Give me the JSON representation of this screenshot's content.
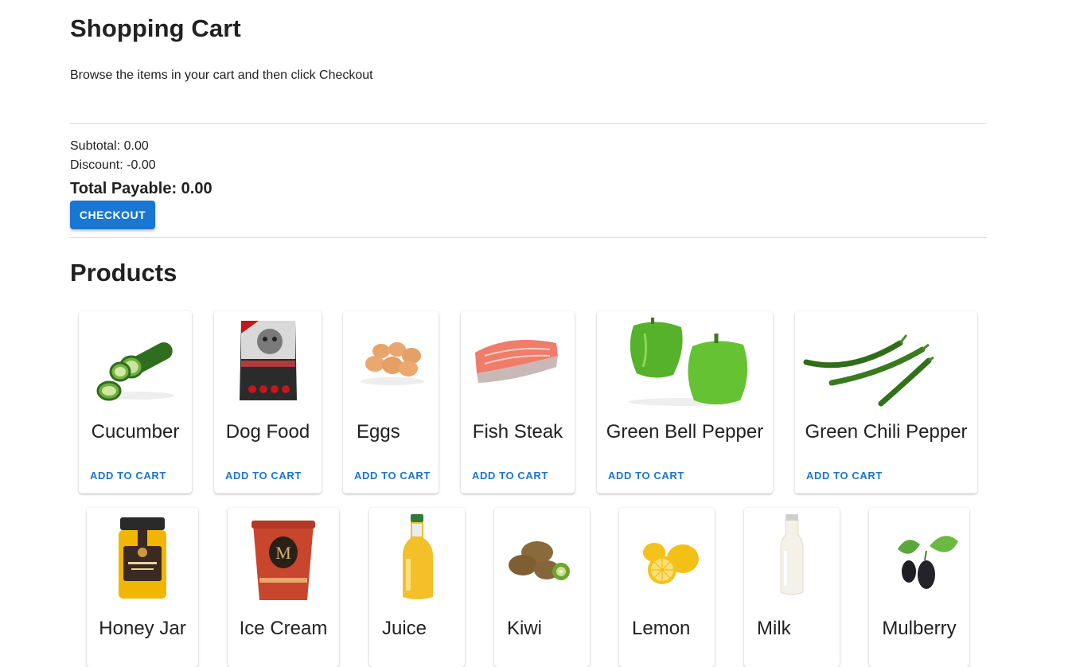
{
  "cart": {
    "title": "Shopping Cart",
    "subtitle": "Browse the items in your cart and then click Checkout",
    "subtotal": "Subtotal: 0.00",
    "discount": "Discount: -0.00",
    "total": "Total Payable: 0.00",
    "checkout_label": "CHECKOUT"
  },
  "products": {
    "title": "Products",
    "add_label": "ADD TO CART",
    "items": [
      {
        "name": "Cucumber",
        "icon": "cucumber-icon"
      },
      {
        "name": "Dog Food",
        "icon": "dog-food-icon"
      },
      {
        "name": "Eggs",
        "icon": "eggs-icon"
      },
      {
        "name": "Fish Steak",
        "icon": "fish-steak-icon"
      },
      {
        "name": "Green Bell Pepper",
        "icon": "bell-pepper-icon"
      },
      {
        "name": "Green Chili Pepper",
        "icon": "chili-pepper-icon"
      },
      {
        "name": "Honey Jar",
        "icon": "honey-jar-icon"
      },
      {
        "name": "Ice Cream",
        "icon": "ice-cream-icon"
      },
      {
        "name": "Juice",
        "icon": "juice-icon"
      },
      {
        "name": "Kiwi",
        "icon": "kiwi-icon"
      },
      {
        "name": "Lemon",
        "icon": "lemon-icon"
      },
      {
        "name": "Milk",
        "icon": "milk-icon"
      },
      {
        "name": "Mulberry",
        "icon": "mulberry-icon"
      }
    ]
  },
  "colors": {
    "accent": "#1976d2",
    "text": "#212121",
    "divider": "#dcdcdc"
  }
}
